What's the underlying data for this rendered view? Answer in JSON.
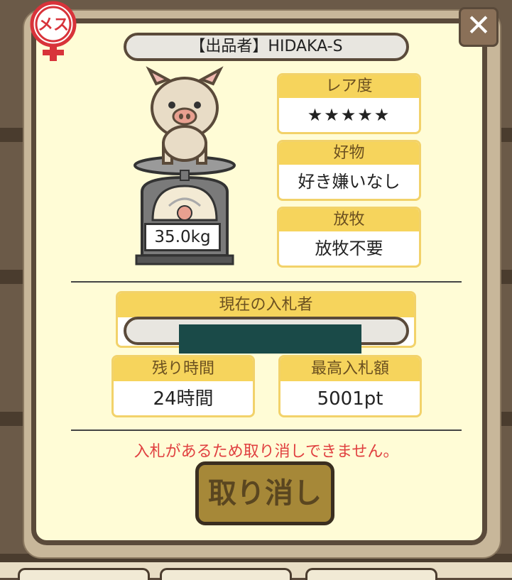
{
  "seller": {
    "label": "【出品者】HIDAKA-S"
  },
  "gender": {
    "label": "メス",
    "color": "#d8333a"
  },
  "close_label": "✕",
  "pig": {
    "weight": "35.0kg"
  },
  "rarity": {
    "header": "レア度",
    "stars": "★★★★★",
    "stars_count": 5
  },
  "favorite": {
    "header": "好物",
    "value": "好き嫌いなし"
  },
  "grazing": {
    "header": "放牧",
    "value": "放牧不要"
  },
  "bidder": {
    "header": "現在の入札者"
  },
  "remaining": {
    "header": "残り時間",
    "value": "24時間"
  },
  "highest_bid": {
    "header": "最高入札額",
    "value": "5001pt"
  },
  "notice": "入札があるため取り消しできません。",
  "cancel_label": "取り消し",
  "colors": {
    "accent": "#f6d45c",
    "warning": "#e04040",
    "frame": "#5a4a3a"
  }
}
